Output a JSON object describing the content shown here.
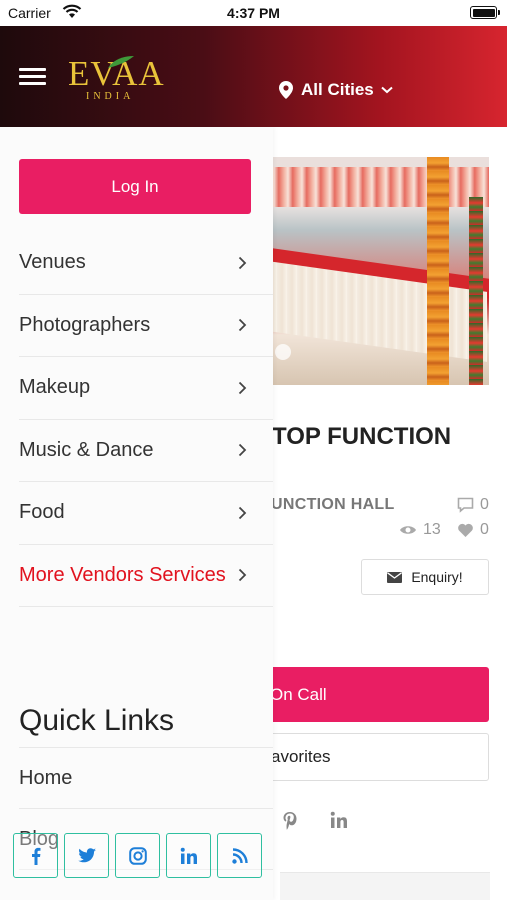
{
  "status_bar": {
    "carrier": "Carrier",
    "time": "4:37 PM"
  },
  "header": {
    "logo_text": "EVAA",
    "logo_subtext": "INDIA",
    "city_selector": "All Cities",
    "colors": {
      "gradient_start": "#1e0a0c",
      "gradient_end": "#d7252f",
      "logo_gold": "#e9c33a"
    }
  },
  "drawer": {
    "login_label": "Log In",
    "menu_items": [
      {
        "label": "Venues"
      },
      {
        "label": "Photographers"
      },
      {
        "label": "Makeup"
      },
      {
        "label": "Music & Dance"
      },
      {
        "label": "Food"
      },
      {
        "label": "More Vendors Services",
        "accent": true
      }
    ],
    "quick_links_title": "Quick Links",
    "quick_links": [
      {
        "label": "Home"
      },
      {
        "label": "Blog"
      }
    ],
    "social_icons": [
      "facebook-icon",
      "twitter-icon",
      "instagram-icon",
      "linkedin-icon",
      "rss-icon"
    ]
  },
  "listing": {
    "title_fragment": "TOP FUNCTION",
    "category_fragment": "UNCTION HALL",
    "comments_count": "0",
    "views_count": "13",
    "likes_count": "0",
    "enquiry_label": "Enquiry!",
    "call_label_fragment": "On Call",
    "favorites_label_fragment": "avorites",
    "share_icons": [
      "pinterest-icon",
      "linkedin-icon"
    ]
  },
  "colors": {
    "primary_pink": "#e91e63",
    "accent_red": "#e1121e",
    "social_teal": "#2fbfa0",
    "social_blue": "#1e7fd8"
  }
}
